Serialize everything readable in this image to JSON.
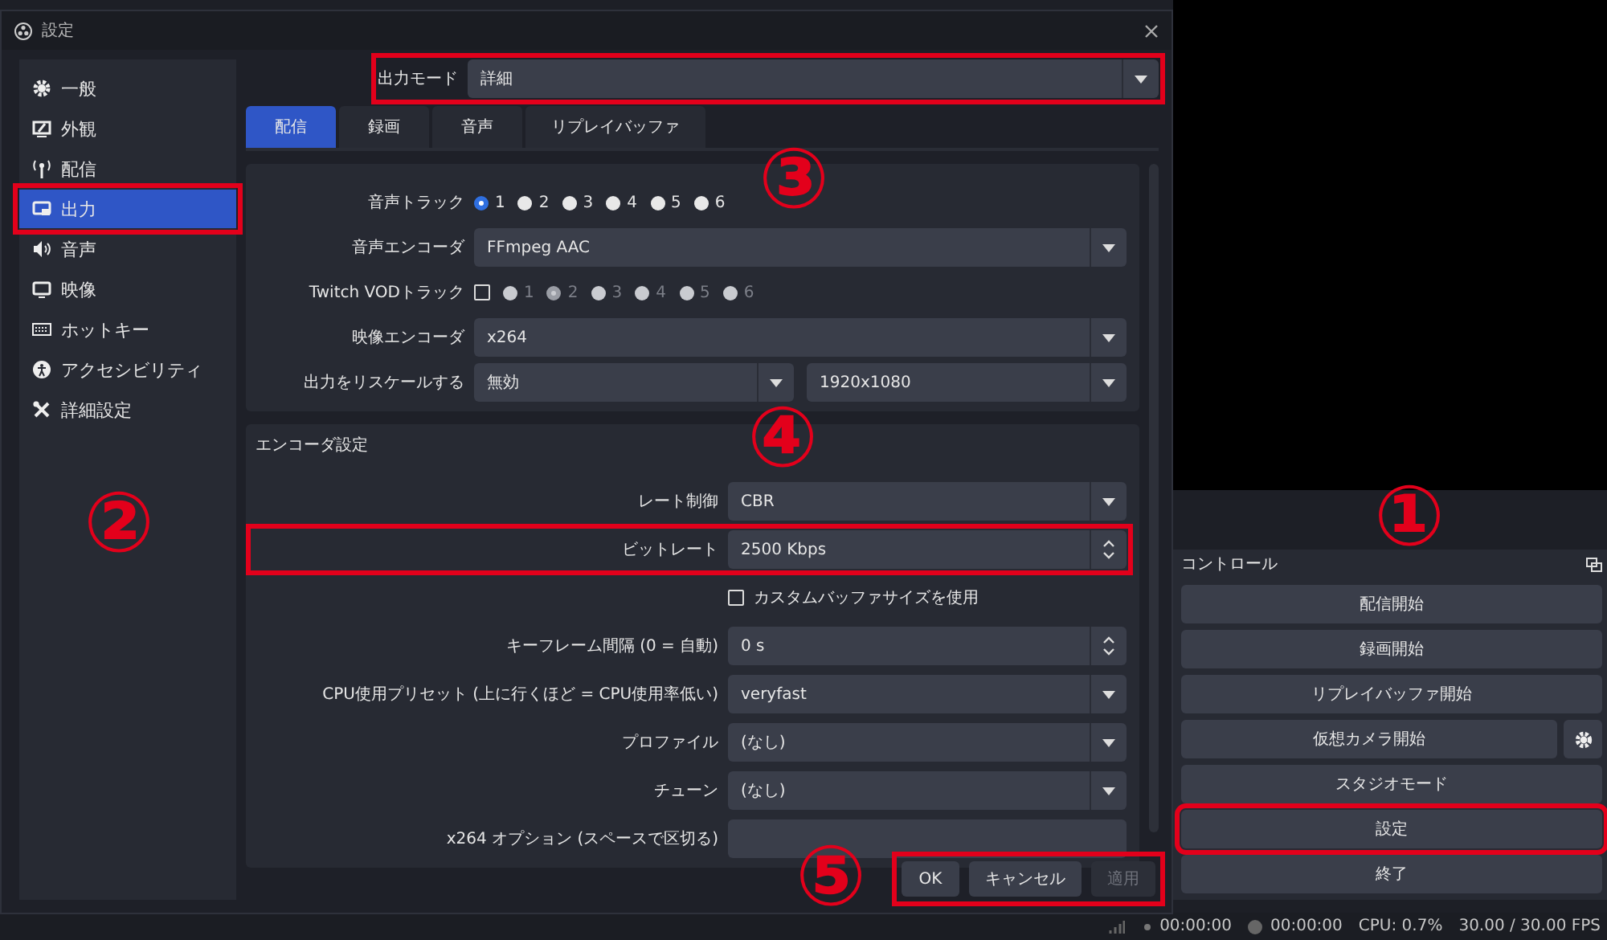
{
  "dialog": {
    "title": "設定",
    "sidebar": [
      {
        "label": "一般",
        "selected": false,
        "highlighted": false
      },
      {
        "label": "外観",
        "selected": false,
        "highlighted": false
      },
      {
        "label": "配信",
        "selected": false,
        "highlighted": false
      },
      {
        "label": "出力",
        "selected": true,
        "highlighted": true
      },
      {
        "label": "音声",
        "selected": false,
        "highlighted": false
      },
      {
        "label": "映像",
        "selected": false,
        "highlighted": false
      },
      {
        "label": "ホットキー",
        "selected": false,
        "highlighted": false
      },
      {
        "label": "アクセシビリティ",
        "selected": false,
        "highlighted": false
      },
      {
        "label": "詳細設定",
        "selected": false,
        "highlighted": false
      }
    ],
    "output_mode": {
      "label": "出力モード",
      "value": "詳細",
      "highlighted": true
    },
    "tabs": [
      {
        "label": "配信",
        "selected": true
      },
      {
        "label": "録画",
        "selected": false
      },
      {
        "label": "音声",
        "selected": false
      },
      {
        "label": "リプレイバッファ",
        "selected": false
      }
    ],
    "stream_group": {
      "rows": [
        {
          "kind": "radios",
          "label": "音声トラック",
          "options": [
            {
              "label": "1",
              "selected": true,
              "disabled": false
            },
            {
              "label": "2",
              "selected": false,
              "disabled": false
            },
            {
              "label": "3",
              "selected": false,
              "disabled": false
            },
            {
              "label": "4",
              "selected": false,
              "disabled": false
            },
            {
              "label": "5",
              "selected": false,
              "disabled": false
            },
            {
              "label": "6",
              "selected": false,
              "disabled": false
            }
          ]
        },
        {
          "kind": "select",
          "label": "音声エンコーダ",
          "value": "FFmpeg AAC"
        },
        {
          "kind": "checkradios",
          "label": "Twitch VODトラック",
          "checked": false,
          "options": [
            {
              "label": "1",
              "selected": false,
              "disabled": true
            },
            {
              "label": "2",
              "selected": true,
              "disabled": true
            },
            {
              "label": "3",
              "selected": false,
              "disabled": true
            },
            {
              "label": "4",
              "selected": false,
              "disabled": true
            },
            {
              "label": "5",
              "selected": false,
              "disabled": true
            },
            {
              "label": "6",
              "selected": false,
              "disabled": true
            }
          ]
        },
        {
          "kind": "select",
          "label": "映像エンコーダ",
          "value": "x264"
        },
        {
          "kind": "select2",
          "label": "出力をリスケールする",
          "values": [
            "無効",
            "1920x1080"
          ]
        }
      ]
    },
    "encoder_group": {
      "title": "エンコーダ設定",
      "rows": [
        {
          "kind": "select",
          "label": "レート制御",
          "value": "CBR"
        },
        {
          "kind": "spin",
          "label": "ビットレート",
          "value": "2500 Kbps",
          "highlighted": true
        },
        {
          "kind": "checkbox",
          "label": "カスタムバッファサイズを使用",
          "checked": false
        },
        {
          "kind": "spin",
          "label": "キーフレーム間隔 (0 = 自動)",
          "value": "0 s"
        },
        {
          "kind": "select",
          "label": "CPU使用プリセット (上に行くほど = CPU使用率低い)",
          "value": "veryfast"
        },
        {
          "kind": "select",
          "label": "プロファイル",
          "value": "(なし)"
        },
        {
          "kind": "select",
          "label": "チューン",
          "value": "(なし)"
        },
        {
          "kind": "text",
          "label": "x264 オプション (スペースで区切る)"
        }
      ]
    },
    "buttons": [
      {
        "label": "OK",
        "disabled": false
      },
      {
        "label": "キャンセル",
        "disabled": false
      },
      {
        "label": "適用",
        "disabled": true
      }
    ],
    "buttons_highlighted": true
  },
  "controls": {
    "title": "コントロール",
    "buttons": [
      {
        "label": "配信開始",
        "kind": "plain",
        "highlighted": false
      },
      {
        "label": "録画開始",
        "kind": "plain",
        "highlighted": false
      },
      {
        "label": "リプレイバッファ開始",
        "kind": "plain",
        "highlighted": false
      },
      {
        "label": "仮想カメラ開始",
        "kind": "with-gear",
        "highlighted": false
      },
      {
        "label": "スタジオモード",
        "kind": "plain",
        "highlighted": false
      },
      {
        "label": "設定",
        "kind": "plain",
        "highlighted": true
      },
      {
        "label": "終了",
        "kind": "plain",
        "highlighted": false
      }
    ]
  },
  "status_bar": {
    "items": [
      "00:00:00",
      "00:00:00",
      "CPU: 0.7%",
      "30.00 / 30.00 FPS"
    ]
  },
  "callouts": [
    "①",
    "②",
    "③",
    "④",
    "⑤"
  ]
}
